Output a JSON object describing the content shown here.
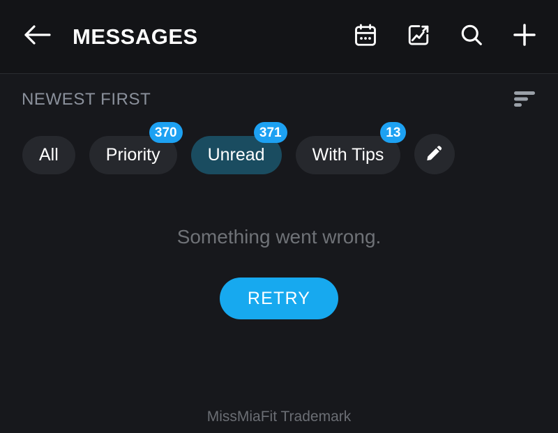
{
  "appbar": {
    "back_icon": "arrow-left-icon",
    "title": "MESSAGES",
    "actions": [
      {
        "icon": "calendar-icon",
        "name": "calendar-button"
      },
      {
        "icon": "photo-insights-icon",
        "name": "media-insights-button"
      },
      {
        "icon": "search-icon",
        "name": "search-button"
      },
      {
        "icon": "plus-icon",
        "name": "new-message-button"
      }
    ]
  },
  "sort": {
    "label": "NEWEST FIRST",
    "icon": "sort-filter-icon"
  },
  "filters": {
    "chips": [
      {
        "label": "All",
        "badge": "",
        "selected": false
      },
      {
        "label": "Priority",
        "badge": "370",
        "selected": false
      },
      {
        "label": "Unread",
        "badge": "371",
        "selected": true
      },
      {
        "label": "With Tips",
        "badge": "13",
        "selected": false
      }
    ],
    "edit_icon": "pencil-icon"
  },
  "main": {
    "error_message": "Something went wrong.",
    "retry_label": "RETRY"
  },
  "footer": {
    "trademark": "MissMiaFit Trademark"
  },
  "colors": {
    "background": "#17181c",
    "appbar_background": "#131417",
    "accent": "#1da1f2",
    "retry_button": "#17a9ef",
    "chip_background": "#26282d",
    "chip_selected_background": "#1a4c60",
    "muted_text": "#8b919c"
  }
}
